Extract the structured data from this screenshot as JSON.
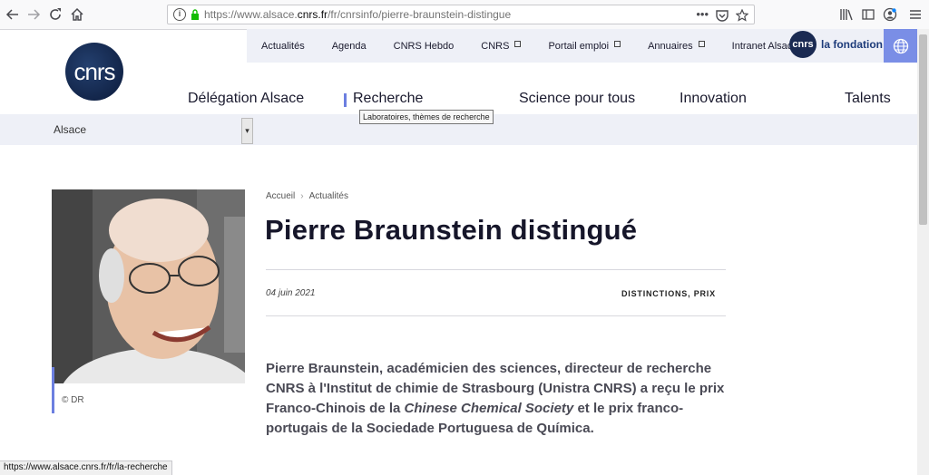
{
  "browser": {
    "url_prefix": "https://www.alsace.",
    "url_domain": "cnrs.fr",
    "url_path": "/fr/cnrsinfo/pierre-braunstein-distingue",
    "icons": [
      "back-icon",
      "forward-icon",
      "reload-icon",
      "home-icon",
      "info-icon",
      "lock-icon",
      "more-icon",
      "pocket-icon",
      "bookmark-star-icon",
      "library-icon",
      "sidebar-icon",
      "account-icon",
      "menu-icon"
    ]
  },
  "logo": {
    "text": "cnrs"
  },
  "top_nav": [
    {
      "label": "Actualités",
      "external": false
    },
    {
      "label": "Agenda",
      "external": false
    },
    {
      "label": "CNRS Hebdo",
      "external": false
    },
    {
      "label": "CNRS",
      "external": true
    },
    {
      "label": "Portail emploi",
      "external": true
    },
    {
      "label": "Annuaires",
      "external": true
    },
    {
      "label": "Intranet Alsace",
      "external": true
    }
  ],
  "fondation": {
    "logo_text": "cnrs",
    "label": "la fondation"
  },
  "main_nav": {
    "delegation": "Délégation Alsace",
    "recherche": "Recherche",
    "science": "Science pour tous",
    "innovation": "Innovation",
    "talents": "Talents"
  },
  "tooltip": "Laboratoires, thèmes de recherche",
  "sub_nav": {
    "selected": "Alsace"
  },
  "article": {
    "breadcrumb": [
      "Accueil",
      "Actualités"
    ],
    "title": "Pierre Braunstein distingué",
    "date": "04 juin 2021",
    "tags": "DISTINCTIONS, PRIX",
    "photo_credit": "© DR",
    "lead_before": "Pierre Braunstein, académicien des sciences, directeur de recherche CNRS à l'Institut de chimie de Strasbourg (Unistra CNRS) a reçu le prix Franco-Chinois de la ",
    "lead_italic": "Chinese Chemical Society",
    "lead_after": " et le prix franco-portugais de la Sociedade Portuguesa de Química."
  },
  "status_url": "https://www.alsace.cnrs.fr/fr/la-recherche",
  "colors": {
    "accent": "#6c7fe0",
    "nav_bg": "#eef0f7",
    "brand_dark": "#0b1a3a"
  }
}
